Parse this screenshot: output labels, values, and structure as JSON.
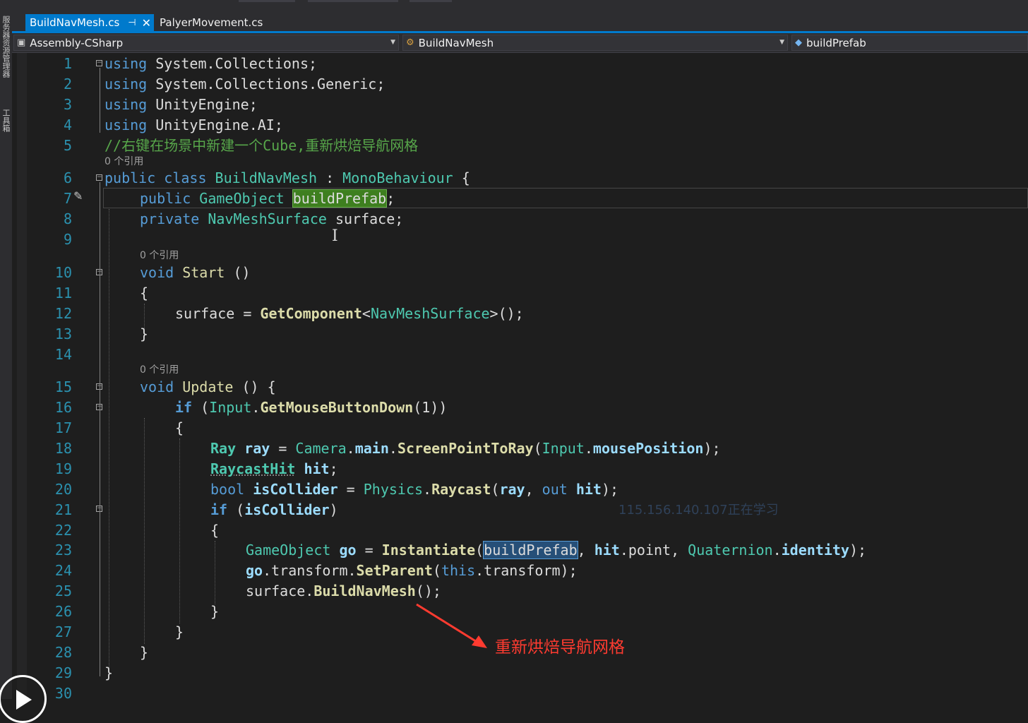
{
  "tabs": [
    {
      "label": "BuildNavMesh.cs",
      "active": true,
      "pin_glyph": "⊣",
      "close_glyph": "✕"
    },
    {
      "label": "PalyerMovement.cs",
      "active": false
    }
  ],
  "sidebar": {
    "label_top": "服务器资源管理器",
    "label_bottom": "工具箱"
  },
  "navbar": {
    "project": "Assembly-CSharp",
    "type": "BuildNavMesh",
    "member": "buildPrefab"
  },
  "line_numbers": [
    "1",
    "2",
    "3",
    "4",
    "5",
    "6",
    "7",
    "8",
    "9",
    "10",
    "11",
    "12",
    "13",
    "14",
    "15",
    "16",
    "17",
    "18",
    "19",
    "20",
    "21",
    "22",
    "23",
    "24",
    "25",
    "26",
    "27",
    "28",
    "29",
    "30"
  ],
  "references": {
    "class_refs": "0 个引用",
    "start_refs": "0 个引用",
    "update_refs": "0 个引用"
  },
  "code": {
    "l1": {
      "kw": "using",
      "rest": " System.Collections;"
    },
    "l2": {
      "kw": "using",
      "rest": " System.Collections.Generic;"
    },
    "l3": {
      "kw": "using",
      "rest": " UnityEngine;"
    },
    "l4": {
      "kw": "using",
      "rest": " UnityEngine.AI;"
    },
    "l5": {
      "comment": "//右键在场景中新建一个Cube,重新烘焙导航网格"
    },
    "l6": {
      "kw": "public class",
      "name": " BuildNavMesh ",
      "colon": ": ",
      "base": "MonoBehaviour",
      "brace": " {"
    },
    "l7": {
      "kw": "public",
      "type": " GameObject",
      "sp": " ",
      "field": "buildPrefab",
      "end": ";"
    },
    "l8": {
      "kw": "private",
      "type": " NavMeshSurface",
      "rest": " surface;"
    },
    "l10": {
      "kw": "void",
      "name": " Start",
      "rest": " ()"
    },
    "l11": {
      "text": "{"
    },
    "l12": {
      "pre": "surface = ",
      "method": "GetComponent",
      "lt": "<",
      "type": "NavMeshSurface",
      "rest": ">();"
    },
    "l13": {
      "text": "}"
    },
    "l15": {
      "kw": "void",
      "name": " Update",
      "rest": " () {"
    },
    "l16": {
      "kw": "if",
      "p1": " (",
      "type": "Input",
      "dot": ".",
      "method": "GetMouseButtonDown",
      "rest": "(1))"
    },
    "l17": {
      "text": "{"
    },
    "l18": {
      "type": "Ray",
      "var": " ray",
      "eq": " = ",
      "type2": "Camera",
      "dot": ".",
      "m1": "main",
      "dot2": ".",
      "method": "ScreenPointToRay",
      "p": "(",
      "type3": "Input",
      "dot3": ".",
      "m2": "mousePosition",
      "end": ");"
    },
    "l19": {
      "type": "RaycastHit",
      "var": " hit",
      "end": ";"
    },
    "l20": {
      "kw": "bool",
      "var": " isCollider",
      "eq": " = ",
      "type": "Physics",
      "dot": ".",
      "method": "Raycast",
      "p": "(",
      "a1": "ray",
      "comma": ", ",
      "kw2": "out",
      "a2": " hit",
      "end": ");"
    },
    "l21": {
      "kw": "if",
      "p": " (",
      "var": "isCollider",
      "end": ")"
    },
    "l22": {
      "text": "{"
    },
    "l23": {
      "type": "GameObject",
      "var": " go",
      "eq": " = ",
      "method": "Instantiate",
      "p": "(",
      "arg": "buildPrefab",
      "comma": ", ",
      "v2": "hit",
      "rest": ".point, ",
      "type2": "Quaternion",
      "dot": ".",
      "m2": "identity",
      "end": ");"
    },
    "l24": {
      "var": "go",
      "rest": ".transform.",
      "method": "SetParent",
      "p": "(",
      "kw": "this",
      "end": ".transform);"
    },
    "l25": {
      "pre": "surface.",
      "method": "BuildNavMesh",
      "end": "();"
    },
    "l26": {
      "text": "}"
    },
    "l27": {
      "text": "}"
    },
    "l28": {
      "text": "}"
    },
    "l29": {
      "text": "}"
    }
  },
  "annotation": "重新烘焙导航网格",
  "watermark": "115.156.140.107正在学习",
  "colors": {
    "accent": "#007acc",
    "keyword": "#569cd6",
    "type": "#4ec9b0",
    "comment": "#57a64a",
    "annotation": "#ff3b30"
  }
}
